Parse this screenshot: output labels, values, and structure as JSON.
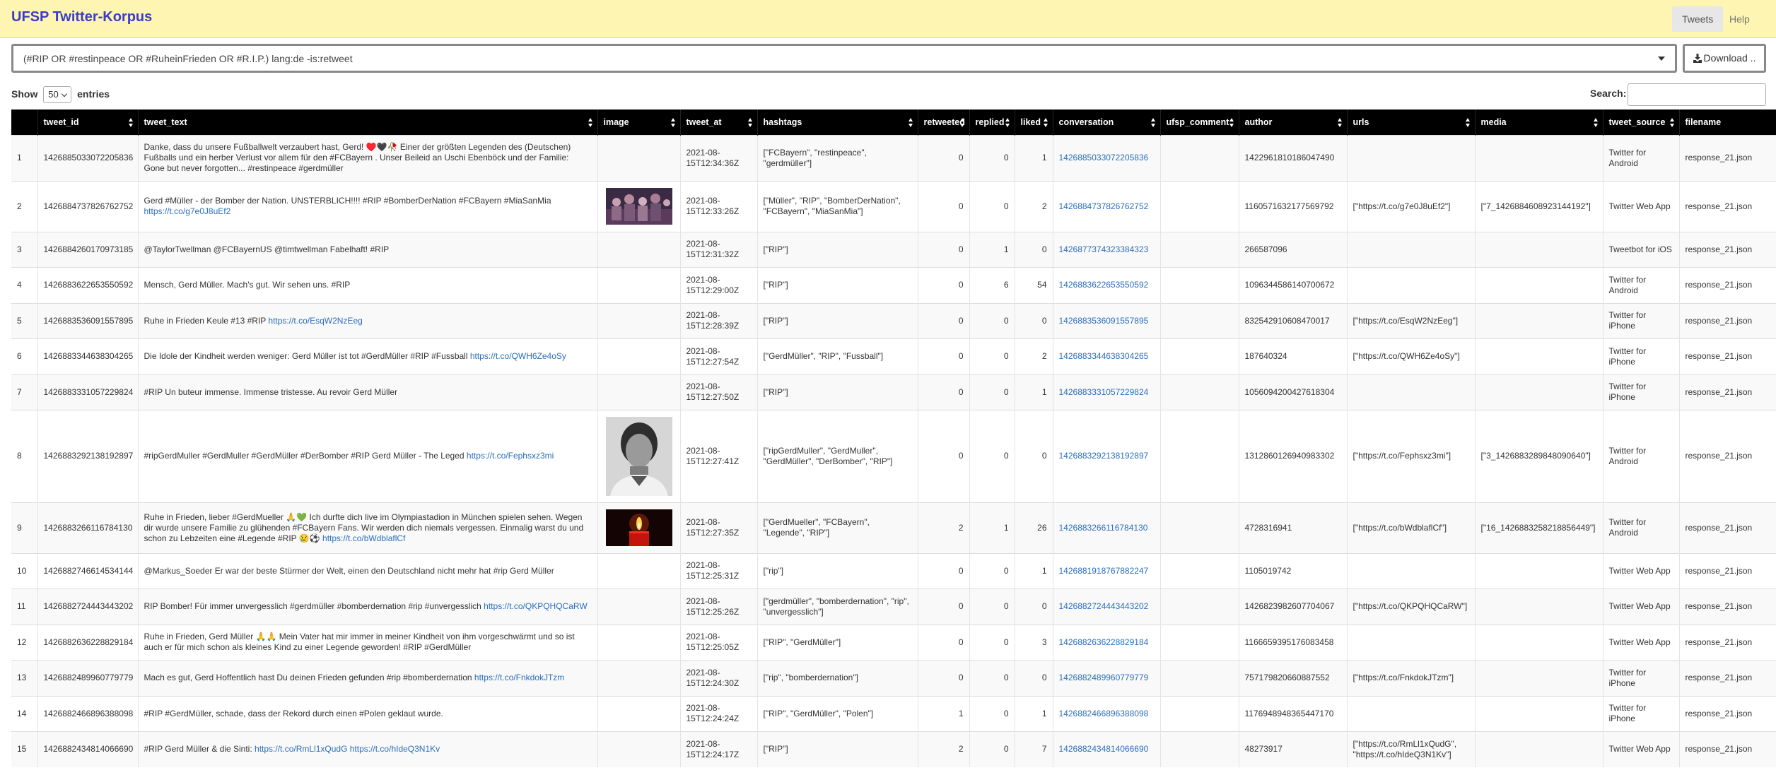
{
  "app": {
    "title": "UFSP Twitter-Korpus"
  },
  "nav": {
    "tabs": [
      {
        "label": "Tweets"
      },
      {
        "label": "Help"
      }
    ]
  },
  "query": {
    "value": "(#RIP OR #restinpeace OR #RuheinFrieden OR #R.I.P.) lang:de -is:retweet"
  },
  "download": {
    "label": "Download .."
  },
  "table_controls": {
    "show_label": "Show",
    "length_value": "50",
    "entries_label": "entries",
    "search_label": "Search:"
  },
  "columns": [
    "",
    "tweet_id",
    "tweet_text",
    "image",
    "tweet_at",
    "hashtags",
    "retweeted",
    "replied",
    "liked",
    "conversation",
    "ufsp_comment",
    "author",
    "urls",
    "media",
    "tweet_source",
    "filename"
  ],
  "rows": [
    {
      "n": "1",
      "tweet_id": "1426885033072205836",
      "text": "Danke, dass du unsere Fußballwelt verzaubert hast, Gerd! ♥️🖤🥀 Einer der größten Legenden des (Deutschen) Fußballs und ein herber Verlust vor allem für den #FCBayern . Unser Beileid an Uschi Ebenböck und der Familie: Gone but never forgotten... #restinpeace #gerdmüller",
      "link": "",
      "image": "",
      "tweet_at": "2021-08-15T12:34:36Z",
      "hashtags": "[\"FCBayern\", \"restinpeace\", \"gerdmüller\"]",
      "retweeted": "0",
      "replied": "0",
      "liked": "1",
      "conversation": "1426885033072205836",
      "ufsp_comment": "",
      "author": "1422961810186047490",
      "urls": "",
      "media": "",
      "source": "Twitter for Android",
      "filename": "response_21.json"
    },
    {
      "n": "2",
      "tweet_id": "1426884737826762752",
      "text": "Gerd #Müller - der Bomber der Nation. UNSTERBLICH!!!! #RIP #BomberDerNation #FCBayern #MiaSanMia",
      "link": "https://t.co/g7e0J8uEf2",
      "image": "crowd",
      "tweet_at": "2021-08-15T12:33:26Z",
      "hashtags": "[\"Müller\", \"RIP\", \"BomberDerNation\", \"FCBayern\", \"MiaSanMia\"]",
      "retweeted": "0",
      "replied": "0",
      "liked": "2",
      "conversation": "1426884737826762752",
      "ufsp_comment": "",
      "author": "1160571632177569792",
      "urls": "[\"https://t.co/g7e0J8uEf2\"]",
      "media": "[\"7_1426884608923144192\"]",
      "source": "Twitter Web App",
      "filename": "response_21.json"
    },
    {
      "n": "3",
      "tweet_id": "1426884260170973185",
      "text": "@TaylorTwellman @FCBayernUS @timtwellman Fabelhaft! #RIP",
      "link": "",
      "image": "",
      "tweet_at": "2021-08-15T12:31:32Z",
      "hashtags": "[\"RIP\"]",
      "retweeted": "0",
      "replied": "1",
      "liked": "0",
      "conversation": "1426877374323384323",
      "ufsp_comment": "",
      "author": "266587096",
      "urls": "",
      "media": "",
      "source": "Tweetbot for iOS",
      "filename": "response_21.json"
    },
    {
      "n": "4",
      "tweet_id": "1426883622653550592",
      "text": "Mensch, Gerd Müller. Mach's gut. Wir sehen uns. #RIP",
      "link": "",
      "image": "",
      "tweet_at": "2021-08-15T12:29:00Z",
      "hashtags": "[\"RIP\"]",
      "retweeted": "0",
      "replied": "6",
      "liked": "54",
      "conversation": "1426883622653550592",
      "ufsp_comment": "",
      "author": "1096344586140700672",
      "urls": "",
      "media": "",
      "source": "Twitter for Android",
      "filename": "response_21.json"
    },
    {
      "n": "5",
      "tweet_id": "1426883536091557895",
      "text": "Ruhe in Frieden Keule #13 #RIP",
      "link": "https://t.co/EsqW2NzEeg",
      "image": "",
      "tweet_at": "2021-08-15T12:28:39Z",
      "hashtags": "[\"RIP\"]",
      "retweeted": "0",
      "replied": "0",
      "liked": "0",
      "conversation": "1426883536091557895",
      "ufsp_comment": "",
      "author": "832542910608470017",
      "urls": "[\"https://t.co/EsqW2NzEeg\"]",
      "media": "",
      "source": "Twitter for iPhone",
      "filename": "response_21.json"
    },
    {
      "n": "6",
      "tweet_id": "1426883344638304265",
      "text": "Die Idole der Kindheit werden weniger: Gerd Müller ist tot #GerdMüller #RIP #Fussball",
      "link": "https://t.co/QWH6Ze4oSy",
      "image": "",
      "tweet_at": "2021-08-15T12:27:54Z",
      "hashtags": "[\"GerdMüller\", \"RIP\", \"Fussball\"]",
      "retweeted": "0",
      "replied": "0",
      "liked": "2",
      "conversation": "1426883344638304265",
      "ufsp_comment": "",
      "author": "187640324",
      "urls": "[\"https://t.co/QWH6Ze4oSy\"]",
      "media": "",
      "source": "Twitter for iPhone",
      "filename": "response_21.json"
    },
    {
      "n": "7",
      "tweet_id": "1426883331057229824",
      "text": "#RIP Un buteur immense. Immense tristesse. Au revoir Gerd Müller",
      "link": "",
      "image": "",
      "tweet_at": "2021-08-15T12:27:50Z",
      "hashtags": "[\"RIP\"]",
      "retweeted": "0",
      "replied": "0",
      "liked": "1",
      "conversation": "1426883331057229824",
      "ufsp_comment": "",
      "author": "1056094200427618304",
      "urls": "",
      "media": "",
      "source": "Twitter for iPhone",
      "filename": "response_21.json"
    },
    {
      "n": "8",
      "tweet_id": "1426883292138192897",
      "text": "#ripGerdMuller #GerdMuller #GerdMüller #DerBomber #RIP Gerd Müller - The Leged",
      "link": "https://t.co/Fephsxz3mi",
      "image": "portrait",
      "tweet_at": "2021-08-15T12:27:41Z",
      "hashtags": "[\"ripGerdMuller\", \"GerdMuller\", \"GerdMüller\", \"DerBomber\", \"RIP\"]",
      "retweeted": "0",
      "replied": "0",
      "liked": "0",
      "conversation": "1426883292138192897",
      "ufsp_comment": "",
      "author": "1312860126940983302",
      "urls": "[\"https://t.co/Fephsxz3mi\"]",
      "media": "[\"3_1426883289848090640\"]",
      "source": "Twitter for Android",
      "filename": "response_21.json"
    },
    {
      "n": "9",
      "tweet_id": "1426883266116784130",
      "text": "Ruhe in Frieden, lieber #GerdMueller 🙏💚 Ich durfte dich live im Olympiastadion in München spielen sehen. Wegen dir wurde unsere Familie zu glühenden #FCBayern Fans. Wir werden dich niemals vergessen. Einmalig warst du und schon zu Lebzeiten eine #Legende #RIP 😢⚽",
      "link": "https://t.co/bWdblaflCf",
      "image": "candle",
      "tweet_at": "2021-08-15T12:27:35Z",
      "hashtags": "[\"GerdMueller\", \"FCBayern\", \"Legende\", \"RIP\"]",
      "retweeted": "2",
      "replied": "1",
      "liked": "26",
      "conversation": "1426883266116784130",
      "ufsp_comment": "",
      "author": "4728316941",
      "urls": "[\"https://t.co/bWdblaflCf\"]",
      "media": "[\"16_1426883258218856449\"]",
      "source": "Twitter for Android",
      "filename": "response_21.json"
    },
    {
      "n": "10",
      "tweet_id": "1426882746614534144",
      "text": "@Markus_Soeder Er war der beste Stürmer der Welt, einen den Deutschland nicht mehr hat #rip Gerd Müller",
      "link": "",
      "image": "",
      "tweet_at": "2021-08-15T12:25:31Z",
      "hashtags": "[\"rip\"]",
      "retweeted": "0",
      "replied": "0",
      "liked": "1",
      "conversation": "1426881918767882247",
      "ufsp_comment": "",
      "author": "1105019742",
      "urls": "",
      "media": "",
      "source": "Twitter Web App",
      "filename": "response_21.json"
    },
    {
      "n": "11",
      "tweet_id": "1426882724443443202",
      "text": "RIP Bomber! Für immer unvergesslich #gerdmüller #bomberdernation #rip #unvergesslich",
      "link": "https://t.co/QKPQHQCaRW",
      "image": "",
      "tweet_at": "2021-08-15T12:25:26Z",
      "hashtags": "[\"gerdmüller\", \"bomberdernation\", \"rip\", \"unvergesslich\"]",
      "retweeted": "0",
      "replied": "0",
      "liked": "0",
      "conversation": "1426882724443443202",
      "ufsp_comment": "",
      "author": "1426823982607704067",
      "urls": "[\"https://t.co/QKPQHQCaRW\"]",
      "media": "",
      "source": "Twitter Web App",
      "filename": "response_21.json"
    },
    {
      "n": "12",
      "tweet_id": "1426882636228829184",
      "text": "Ruhe in Frieden, Gerd Müller 🙏🙏 Mein Vater hat mir immer in meiner Kindheit von ihm vorgeschwärmt und so ist auch er für mich schon als kleines Kind zu einer Legende geworden! #RIP #GerdMüller",
      "link": "",
      "image": "",
      "tweet_at": "2021-08-15T12:25:05Z",
      "hashtags": "[\"RIP\", \"GerdMüller\"]",
      "retweeted": "0",
      "replied": "0",
      "liked": "3",
      "conversation": "1426882636228829184",
      "ufsp_comment": "",
      "author": "1166659395176083458",
      "urls": "",
      "media": "",
      "source": "Twitter Web App",
      "filename": "response_21.json"
    },
    {
      "n": "13",
      "tweet_id": "1426882489960779779",
      "text": "Mach es gut, Gerd Hoffentlich hast Du deinen Frieden gefunden #rip #bomberdernation",
      "link": "https://t.co/FnkdokJTzm",
      "image": "",
      "tweet_at": "2021-08-15T12:24:30Z",
      "hashtags": "[\"rip\", \"bomberdernation\"]",
      "retweeted": "0",
      "replied": "0",
      "liked": "0",
      "conversation": "1426882489960779779",
      "ufsp_comment": "",
      "author": "757179820660887552",
      "urls": "[\"https://t.co/FnkdokJTzm\"]",
      "media": "",
      "source": "Twitter for iPhone",
      "filename": "response_21.json"
    },
    {
      "n": "14",
      "tweet_id": "1426882466896388098",
      "text": "#RIP #GerdMüller, schade, dass der Rekord durch einen #Polen geklaut wurde.",
      "link": "",
      "image": "",
      "tweet_at": "2021-08-15T12:24:24Z",
      "hashtags": "[\"RIP\", \"GerdMüller\", \"Polen\"]",
      "retweeted": "1",
      "replied": "0",
      "liked": "1",
      "conversation": "1426882466896388098",
      "ufsp_comment": "",
      "author": "1176948948365447170",
      "urls": "",
      "media": "",
      "source": "Twitter for iPhone",
      "filename": "response_21.json"
    },
    {
      "n": "15",
      "tweet_id": "1426882434814066690",
      "text": "#RIP Gerd Müller & die Sinti:",
      "link": "https://t.co/RmLl1xQudG https://t.co/hIdeQ3N1Kv",
      "image": "",
      "tweet_at": "2021-08-15T12:24:17Z",
      "hashtags": "[\"RIP\"]",
      "retweeted": "2",
      "replied": "0",
      "liked": "7",
      "conversation": "1426882434814066690",
      "ufsp_comment": "",
      "author": "48273917",
      "urls": "[\"https://t.co/RmLl1xQudG\", \"https://t.co/hIdeQ3N1Kv\"]",
      "media": "",
      "source": "Twitter Web App",
      "filename": "response_21.json"
    }
  ]
}
